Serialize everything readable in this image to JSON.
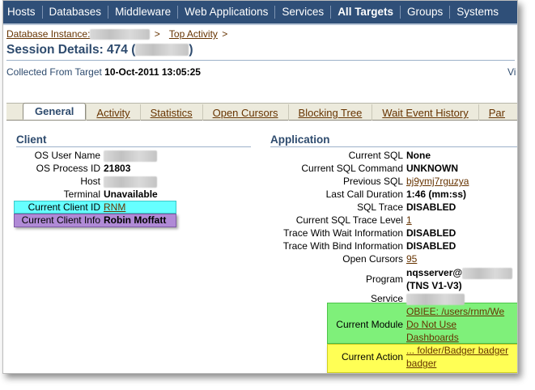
{
  "nav": {
    "items": [
      {
        "label": "Hosts",
        "active": false
      },
      {
        "label": "Databases",
        "active": false
      },
      {
        "label": "Middleware",
        "active": false
      },
      {
        "label": "Web Applications",
        "active": false
      },
      {
        "label": "Services",
        "active": false
      },
      {
        "label": "All Targets",
        "active": true
      },
      {
        "label": "Groups",
        "active": false
      },
      {
        "label": "Systems",
        "active": false
      }
    ]
  },
  "breadcrumb": {
    "database_instance": "Database Instance:",
    "sep": ">",
    "top_activity": "Top Activity"
  },
  "page": {
    "title_prefix": "Session Details: 474 (",
    "title_suffix": ")",
    "collected_label": "Collected From Target",
    "collected_value": "10-Oct-2011 13:05:25",
    "right_cut": "Vi"
  },
  "tabs": [
    {
      "label": "General",
      "active": true
    },
    {
      "label": "Activity",
      "active": false
    },
    {
      "label": "Statistics",
      "active": false
    },
    {
      "label": "Open Cursors",
      "active": false
    },
    {
      "label": "Blocking Tree",
      "active": false
    },
    {
      "label": "Wait Event History",
      "active": false
    },
    {
      "label": "Par",
      "active": false
    }
  ],
  "client": {
    "heading": "Client",
    "os_user_label": "OS User Name",
    "os_process_label": "OS Process ID",
    "os_process_value": "21803",
    "host_label": "Host",
    "terminal_label": "Terminal",
    "terminal_value": "Unavailable",
    "client_id_label": "Current Client ID",
    "client_id_value": "RNM",
    "client_info_label": "Current Client Info",
    "client_info_value": "Robin Moffatt"
  },
  "application": {
    "heading": "Application",
    "current_sql_label": "Current SQL",
    "current_sql_value": "None",
    "sql_command_label": "Current SQL Command",
    "sql_command_value": "UNKNOWN",
    "previous_sql_label": "Previous SQL",
    "previous_sql_value": "bj9ymj7rguzya",
    "last_call_label": "Last Call Duration",
    "last_call_value": "1:46 (mm:ss)",
    "sql_trace_label": "SQL Trace",
    "sql_trace_value": "DISABLED",
    "trace_level_label": "Current SQL Trace Level",
    "trace_level_value": "1",
    "trace_wait_label": "Trace With Wait Information",
    "trace_wait_value": "DISABLED",
    "trace_bind_label": "Trace With Bind Information",
    "trace_bind_value": "DISABLED",
    "open_cursors_label": "Open Cursors",
    "open_cursors_value": "95",
    "program_label": "Program",
    "program_value_1": "nqsserver@",
    "program_value_2": "(TNS V1-V3)",
    "service_label": "Service",
    "module_label": "Current Module",
    "module_value_1": "OBIEE: /users/rnm/We",
    "module_value_2": "Do Not Use",
    "module_value_3": "Dashboards",
    "action_label": "Current Action",
    "action_value_1": "... folder/Badger badger",
    "action_value_2": "badger"
  },
  "colors": {
    "nav_bg": "#2f4f78",
    "link": "#663300",
    "heading": "#2e4b6e",
    "highlight_cyan": "#66ffff",
    "highlight_purple": "#b08ad6",
    "highlight_green": "#7ff07a",
    "highlight_yellow": "#ffff55"
  }
}
